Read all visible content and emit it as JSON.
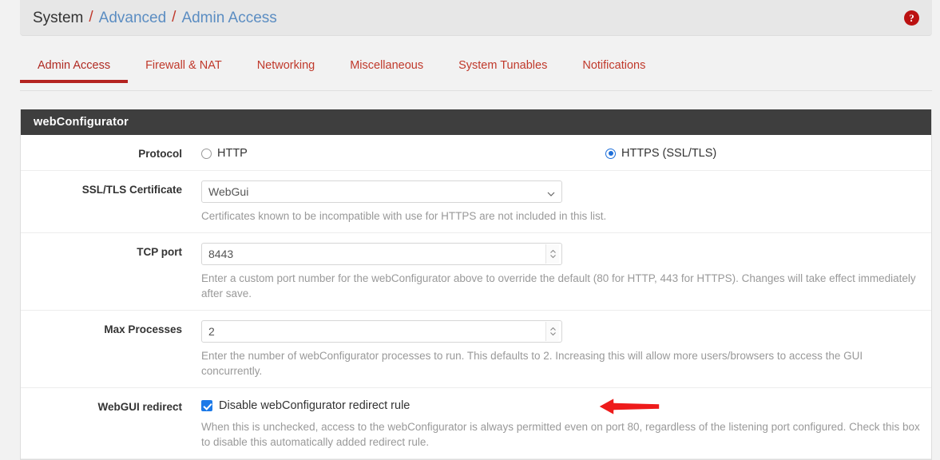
{
  "breadcrumb": {
    "name": "breadcrumb",
    "items": [
      {
        "label": "System",
        "type": "static"
      },
      {
        "label": "Advanced",
        "type": "link"
      },
      {
        "label": "Admin Access",
        "type": "link"
      }
    ],
    "separator": "/",
    "help_icon": "help-circle-icon",
    "help_glyph": "?"
  },
  "tabs": [
    {
      "label": "Admin Access",
      "active": true
    },
    {
      "label": "Firewall & NAT",
      "active": false
    },
    {
      "label": "Networking",
      "active": false
    },
    {
      "label": "Miscellaneous",
      "active": false
    },
    {
      "label": "System Tunables",
      "active": false
    },
    {
      "label": "Notifications",
      "active": false
    }
  ],
  "panel": {
    "heading": "webConfigurator",
    "rows": {
      "protocol": {
        "label": "Protocol",
        "options": [
          {
            "label": "HTTP",
            "selected": false
          },
          {
            "label": "HTTPS (SSL/TLS)",
            "selected": true
          }
        ]
      },
      "certificate": {
        "label": "SSL/TLS Certificate",
        "value": "WebGui",
        "help": "Certificates known to be incompatible with use for HTTPS are not included in this list.",
        "icon": "chevron-down-icon"
      },
      "tcp_port": {
        "label": "TCP port",
        "value": "8443",
        "help": "Enter a custom port number for the webConfigurator above to override the default (80 for HTTP, 443 for HTTPS). Changes will take effect immediately after save.",
        "icon": "spinner-updown-icon"
      },
      "max_processes": {
        "label": "Max Processes",
        "value": "2",
        "help": "Enter the number of webConfigurator processes to run. This defaults to 2. Increasing this will allow more users/browsers to access the GUI concurrently.",
        "icon": "spinner-updown-icon"
      },
      "webgui_redirect": {
        "label": "WebGUI redirect",
        "checkbox_label": "Disable webConfigurator redirect rule",
        "checked": true,
        "help": "When this is unchecked, access to the webConfigurator is always permitted even on port 80, regardless of the listening port configured. Check this box to disable this automatically added redirect rule.",
        "annotation_icon": "left-arrow-annotation-icon"
      }
    }
  },
  "colors": {
    "accent_red": "#b42320",
    "link_blue": "#5b8dc2",
    "panel_header_bg": "#3e3e3e",
    "checkbox_blue": "#1b79e8",
    "radio_blue": "#1e6fd9",
    "annotation_red": "#ee1b1b",
    "page_bg": "#f2f2f2"
  }
}
